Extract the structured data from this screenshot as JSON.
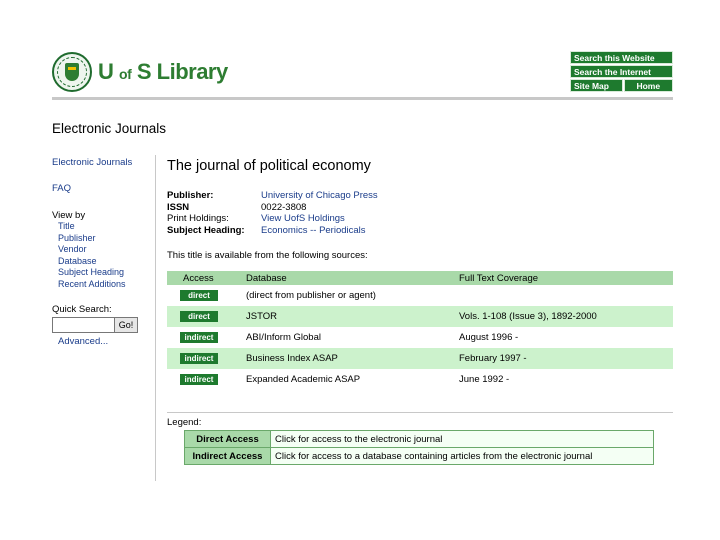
{
  "header": {
    "title_u": "U",
    "title_of": "of",
    "title_rest": "S Library",
    "nav": {
      "search_site": "Search this Website",
      "search_internet": "Search the Internet",
      "site_map": "Site Map",
      "home": "Home"
    }
  },
  "page_heading": "Electronic Journals",
  "sidebar": {
    "electronic_journals": "Electronic Journals",
    "faq": "FAQ",
    "view_by": "View by",
    "view_items": [
      "Title",
      "Publisher",
      "Vendor",
      "Database",
      "Subject Heading",
      "Recent Additions"
    ],
    "quick_search": "Quick Search:",
    "go": "Go!",
    "advanced": "Advanced..."
  },
  "journal": {
    "title": "The journal of political economy",
    "publisher_label": "Publisher:",
    "publisher": "University of Chicago Press",
    "issn_label": "ISSN",
    "issn": "0022-3808",
    "print_label": "Print Holdings:",
    "print": "View UofS Holdings",
    "subject_label": "Subject Heading:",
    "subject": "Economics -- Periodicals",
    "available_text": "This title is available from the following sources:"
  },
  "sources": {
    "headers": [
      "Access",
      "Database",
      "Full Text Coverage"
    ],
    "rows": [
      {
        "access": "direct",
        "database": "(direct from publisher or agent)",
        "coverage": ""
      },
      {
        "access": "direct",
        "database": "JSTOR",
        "coverage": "Vols. 1-108 (Issue 3), 1892-2000"
      },
      {
        "access": "indirect",
        "database": "ABI/Inform Global",
        "coverage": "August 1996 -"
      },
      {
        "access": "indirect",
        "database": "Business Index ASAP",
        "coverage": "February 1997 -"
      },
      {
        "access": "indirect",
        "database": "Expanded Academic ASAP",
        "coverage": "June 1992 -"
      }
    ]
  },
  "legend": {
    "label": "Legend:",
    "direct_key": "Direct Access",
    "direct_desc": "Click for access to the electronic journal",
    "indirect_key": "Indirect Access",
    "indirect_desc": "Click for access to a database containing articles from the electronic journal"
  },
  "colors": {
    "brand_green": "#1e7a2e",
    "header_row": "#a9d9a9",
    "alt_row": "#ccf2cc",
    "link": "#1a3c8a"
  }
}
